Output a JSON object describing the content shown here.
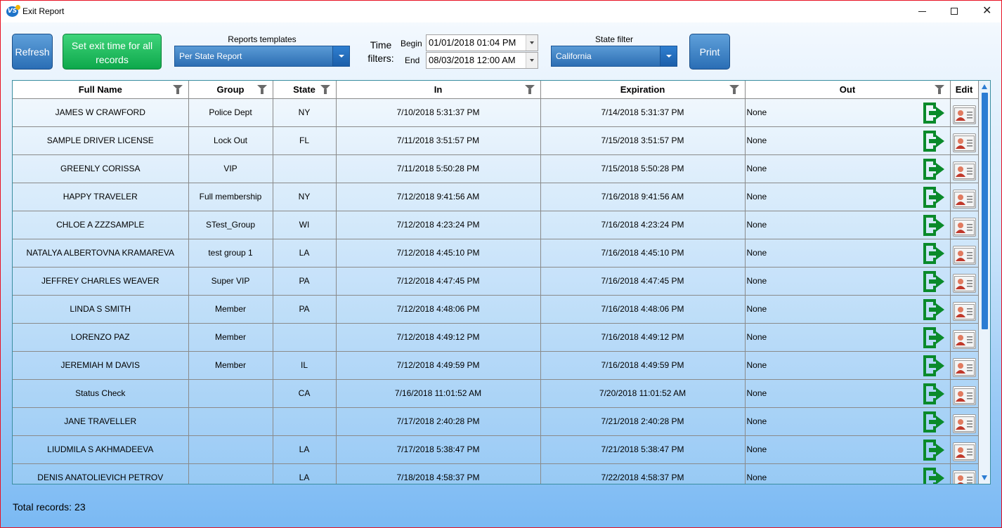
{
  "window": {
    "title": "Exit Report",
    "logo_text": "VS"
  },
  "toolbar": {
    "refresh_label": "Refresh",
    "set_exit_label": "Set exit time for all records",
    "print_label": "Print",
    "templates_label": "Reports templates",
    "templates_value": "Per State Report",
    "time_label": "Time filters:",
    "begin_label": "Begin",
    "end_label": "End",
    "begin_value": "01/01/2018 01:04 PM",
    "end_value": "08/03/2018 12:00 AM",
    "state_label": "State filter",
    "state_value": "California"
  },
  "table": {
    "columns": [
      "Full Name",
      "Group",
      "State",
      "In",
      "Expiration",
      "Out",
      "Edit"
    ],
    "rows": [
      {
        "name": "JAMES W CRAWFORD",
        "group": "Police Dept",
        "state": "NY",
        "in": "7/10/2018 5:31:37 PM",
        "exp": "7/14/2018 5:31:37 PM",
        "out": "None"
      },
      {
        "name": "SAMPLE DRIVER LICENSE",
        "group": "Lock Out",
        "state": "FL",
        "in": "7/11/2018 3:51:57 PM",
        "exp": "7/15/2018 3:51:57 PM",
        "out": "None"
      },
      {
        "name": "GREENLY CORISSA",
        "group": "VIP",
        "state": "",
        "in": "7/11/2018 5:50:28 PM",
        "exp": "7/15/2018 5:50:28 PM",
        "out": "None"
      },
      {
        "name": "HAPPY  TRAVELER",
        "group": "Full membership",
        "state": "NY",
        "in": "7/12/2018 9:41:56 AM",
        "exp": "7/16/2018 9:41:56 AM",
        "out": "None"
      },
      {
        "name": "CHLOE A ZZZSAMPLE",
        "group": "STest_Group",
        "state": "WI",
        "in": "7/12/2018 4:23:24 PM",
        "exp": "7/16/2018 4:23:24 PM",
        "out": "None"
      },
      {
        "name": "NATALYA ALBERTOVNA KRAMAREVA",
        "group": "test group 1",
        "state": "LA",
        "in": "7/12/2018 4:45:10 PM",
        "exp": "7/16/2018 4:45:10 PM",
        "out": "None"
      },
      {
        "name": "JEFFREY CHARLES WEAVER",
        "group": "Super VIP",
        "state": "PA",
        "in": "7/12/2018 4:47:45 PM",
        "exp": "7/16/2018 4:47:45 PM",
        "out": "None"
      },
      {
        "name": "LINDA S SMITH",
        "group": "Member",
        "state": "PA",
        "in": "7/12/2018 4:48:06 PM",
        "exp": "7/16/2018 4:48:06 PM",
        "out": "None"
      },
      {
        "name": "LORENZO  PAZ",
        "group": "Member",
        "state": "",
        "in": "7/12/2018 4:49:12 PM",
        "exp": "7/16/2018 4:49:12 PM",
        "out": "None"
      },
      {
        "name": "JEREMIAH M DAVIS",
        "group": "Member",
        "state": "IL",
        "in": "7/12/2018 4:49:59 PM",
        "exp": "7/16/2018 4:49:59 PM",
        "out": "None"
      },
      {
        "name": "Status  Check",
        "group": "",
        "state": "CA",
        "in": "7/16/2018 11:01:52 AM",
        "exp": "7/20/2018 11:01:52 AM",
        "out": "None"
      },
      {
        "name": "JANE  TRAVELLER",
        "group": "",
        "state": "",
        "in": "7/17/2018 2:40:28 PM",
        "exp": "7/21/2018 2:40:28 PM",
        "out": "None"
      },
      {
        "name": "LIUDMILA S AKHMADEEVA",
        "group": "",
        "state": "LA",
        "in": "7/17/2018 5:38:47 PM",
        "exp": "7/21/2018 5:38:47 PM",
        "out": "None"
      },
      {
        "name": "DENIS ANATOLIEVICH PETROV",
        "group": "",
        "state": "LA",
        "in": "7/18/2018 4:58:37 PM",
        "exp": "7/22/2018 4:58:37 PM",
        "out": "None"
      }
    ]
  },
  "footer": {
    "total_label": "Total records:",
    "total_value": "23"
  },
  "colors": {
    "exit_icon": "#0a8a2a",
    "button_blue": "#2a6eb5",
    "button_green": "#0da84b",
    "scrollbar": "#2b7cd3"
  }
}
